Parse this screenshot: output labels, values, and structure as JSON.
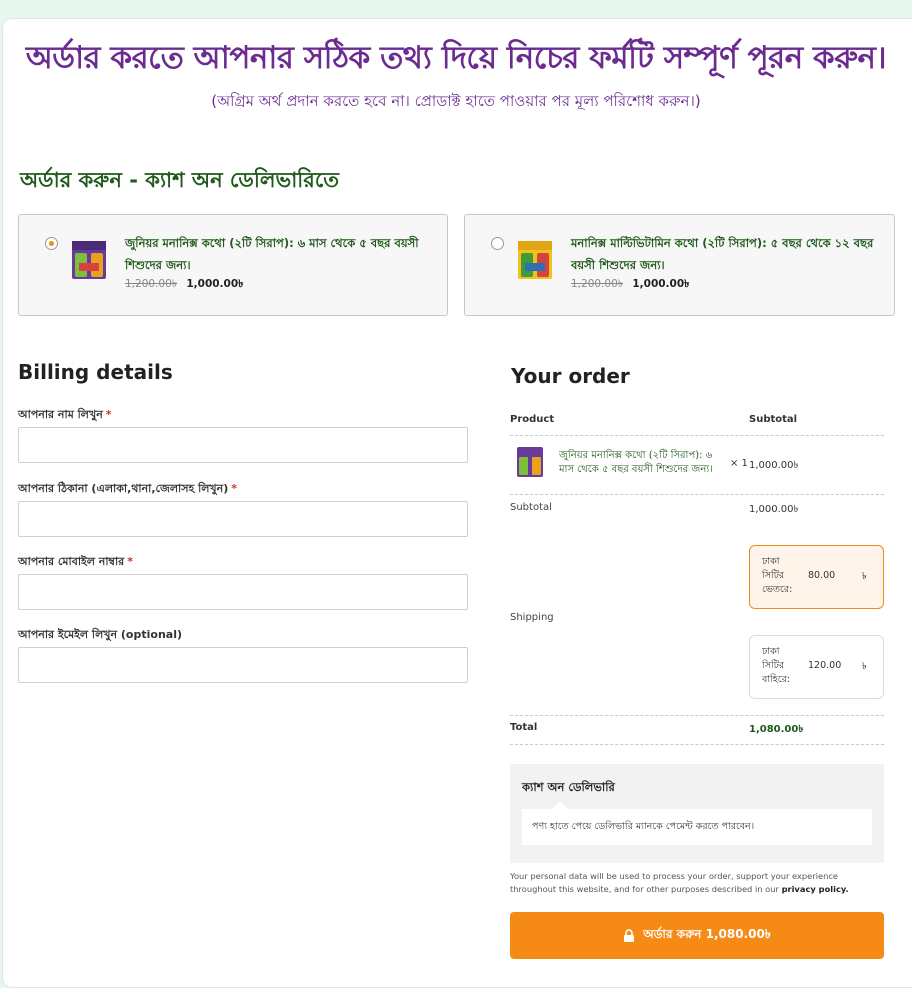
{
  "header": {
    "headline": "অর্ডার করতে আপনার সঠিক তথ্য দিয়ে নিচের ফর্মটি সম্পূর্ণ পূরন করুন।",
    "subhead": "(অগ্রিম অর্থ প্রদান করতে হবে না। প্রোডাক্ট হাতে পাওয়ার পর মূল্য পরিশোধ করুন।)"
  },
  "section_title": "অর্ডার করুন - ক্যাশ অন ডেলিভারিতে",
  "products": [
    {
      "name": "জুনিয়র মনানিক্স কথো (২টি সিরাপ): ৬ মাস থেকে ৫ বছর বয়সী শিশুদের জন্য।",
      "old_price": "1,200.00৳",
      "price": "1,000.00৳",
      "selected": true
    },
    {
      "name": "মনানিক্স মাল্টিভিটামিন কথো (২টি সিরাপ): ৫ বছর থেকে ১২ বছর বয়সী শিশুদের জন্য।",
      "old_price": "1,200.00৳",
      "price": "1,000.00৳",
      "selected": false
    }
  ],
  "billing": {
    "title": "Billing details",
    "fields": [
      {
        "label": "আপনার নাম লিখুন",
        "required": "*",
        "value": ""
      },
      {
        "label": "আপনার ঠিকানা (এলাকা,থানা,জেলাসহ লিখুন)",
        "required": "*",
        "value": ""
      },
      {
        "label": "আপনার মোবাইল নাম্বার",
        "required": "*",
        "value": ""
      },
      {
        "label": "আপনার ইমেইল লিখুন (optional)",
        "required": "",
        "value": ""
      }
    ]
  },
  "order": {
    "title": "Your order",
    "col_product": "Product",
    "col_subtotal": "Subtotal",
    "item": {
      "name": "জুনিয়র মনানিক্স কথো (২টি সিরাপ): ৬ মাস থেকে ৫ বছর বয়সী শিশুদের জন্য।",
      "qty": "× 1",
      "subtotal": "1,000.00৳"
    },
    "subtotal_label": "Subtotal",
    "subtotal_value": "1,000.00৳",
    "shipping_label": "Shipping",
    "shipping_options": [
      {
        "name": "ঢাকা সিটির ভেতরে:",
        "price": "80.00",
        "currency": "৳",
        "selected": true
      },
      {
        "name": "ঢাকা সিটির বাহিরে:",
        "price": "120.00",
        "currency": "৳",
        "selected": false
      }
    ],
    "total_label": "Total",
    "total_value": "1,080.00৳"
  },
  "payment": {
    "title": "ক্যাশ অন ডেলিভারি",
    "description": "পণ্য হাতে পেয়ে ডেলিভারি ম্যানকে পেমেন্ট করতে পারবেন।"
  },
  "privacy": {
    "text": "Your personal data will be used to process your order, support your experience throughout this website, and for other purposes described in our ",
    "link": "privacy policy."
  },
  "place_order": {
    "label": "অর্ডার করুন  1,080.00৳",
    "icon": "lock-icon"
  },
  "colors": {
    "purple": "#6b2b90",
    "green": "#1f5a1a",
    "orange": "#f58a17"
  }
}
